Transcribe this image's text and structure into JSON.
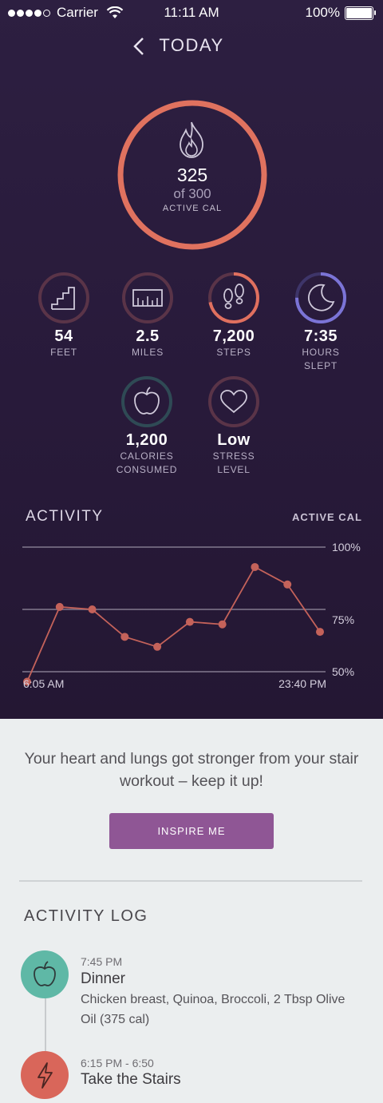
{
  "status": {
    "carrier": "Carrier",
    "time": "11:11 AM",
    "battery": "100%"
  },
  "nav": {
    "title": "TODAY"
  },
  "goal": {
    "value": "325",
    "of_text": "of 300",
    "label": "ACTIVE CAL",
    "progress": 1.0
  },
  "stats": [
    {
      "value": "54",
      "label": "FEET",
      "progress": 0.0,
      "color": "#e0705f"
    },
    {
      "value": "2.5",
      "label": "MILES",
      "progress": 0.0,
      "color": "#e0705f"
    },
    {
      "value": "7,200",
      "label": "STEPS",
      "progress": 0.72,
      "color": "#e0705f"
    },
    {
      "value": "7:35",
      "label": "HOURS\nSLEPT",
      "progress": 0.75,
      "color": "#7b74d6"
    },
    {
      "value": "1,200",
      "label": "CALORIES\nCONSUMED",
      "progress": 0.0,
      "color": "#5fb8a6"
    },
    {
      "value": "Low",
      "label": "STRESS\nLEVEL",
      "progress": 0.0,
      "color": "#e0705f"
    }
  ],
  "activity": {
    "title": "ACTIVITY",
    "unit": "ACTIVE CAL"
  },
  "chart_data": {
    "type": "line",
    "title": "ACTIVITY",
    "ylabel": "ACTIVE CAL",
    "x_start": "6:05 AM",
    "x_end": "23:40 PM",
    "y_ticks": [
      "100%",
      "75%",
      "50%"
    ],
    "ylim": [
      50,
      100
    ],
    "values": [
      46,
      76,
      75,
      64,
      60,
      70,
      69,
      92,
      85,
      66
    ],
    "color": "#c4625a"
  },
  "message": "Your heart and lungs got stronger from your stair workout – keep it up!",
  "inspire_button": "INSPIRE ME",
  "log": {
    "title": "ACTIVITY LOG",
    "items": [
      {
        "time": "7:45 PM",
        "name": "Dinner",
        "desc": "Chicken breast, Quinoa, Broccoli, 2 Tbsp Olive Oil (375 cal)",
        "icon": "apple-icon",
        "color": "#5fb8a6"
      },
      {
        "time": "6:15 PM - 6:50",
        "name": "Take the Stairs",
        "desc": "",
        "icon": "lightning-icon",
        "color": "#d9665a"
      }
    ]
  }
}
